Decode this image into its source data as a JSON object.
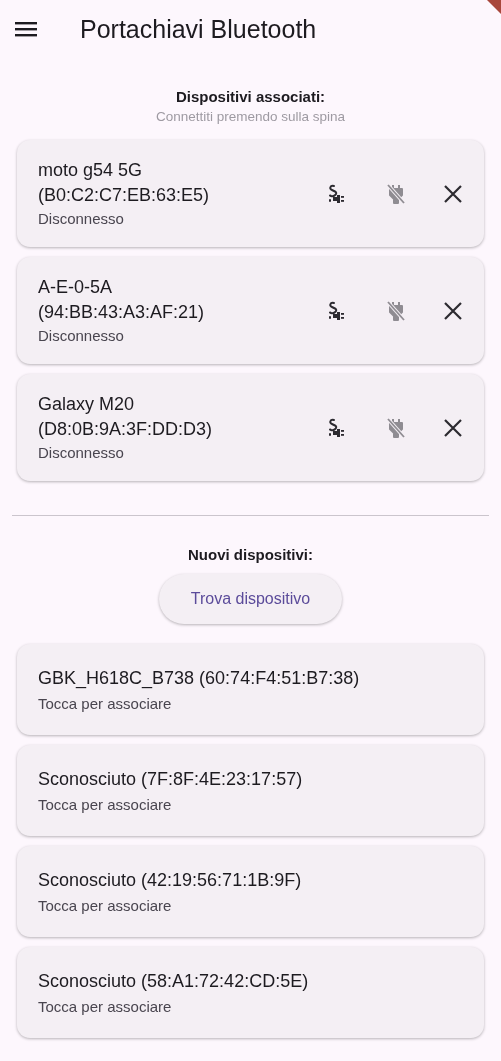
{
  "app_bar": {
    "title": "Portachiavi Bluetooth"
  },
  "paired": {
    "heading": "Dispositivi associati:",
    "hint": "Connettiti premendo sulla spina",
    "devices": [
      {
        "name": "moto g54 5G",
        "address": "(B0:C2:C7:EB:63:E5)",
        "status": "Disconnesso",
        "connect_disabled": false,
        "disconnect_disabled": true
      },
      {
        "name": "A-E-0-5A",
        "address": "(94:BB:43:A3:AF:21)",
        "status": "Disconnesso",
        "connect_disabled": false,
        "disconnect_disabled": true
      },
      {
        "name": "Galaxy M20",
        "address": "(D8:0B:9A:3F:DD:D3)",
        "status": "Disconnesso",
        "connect_disabled": false,
        "disconnect_disabled": true
      }
    ]
  },
  "new": {
    "heading": "Nuovi dispositivi:",
    "button": "Trova dispositivo",
    "devices": [
      {
        "title": "GBK_H618C_B738 (60:74:F4:51:B7:38)",
        "subtitle": "Tocca per associare"
      },
      {
        "title": "Sconosciuto (7F:8F:4E:23:17:57)",
        "subtitle": "Tocca per associare"
      },
      {
        "title": "Sconosciuto (42:19:56:71:1B:9F)",
        "subtitle": "Tocca per associare"
      },
      {
        "title": "Sconosciuto (58:A1:72:42:CD:5E)",
        "subtitle": "Tocca per associare"
      }
    ]
  }
}
